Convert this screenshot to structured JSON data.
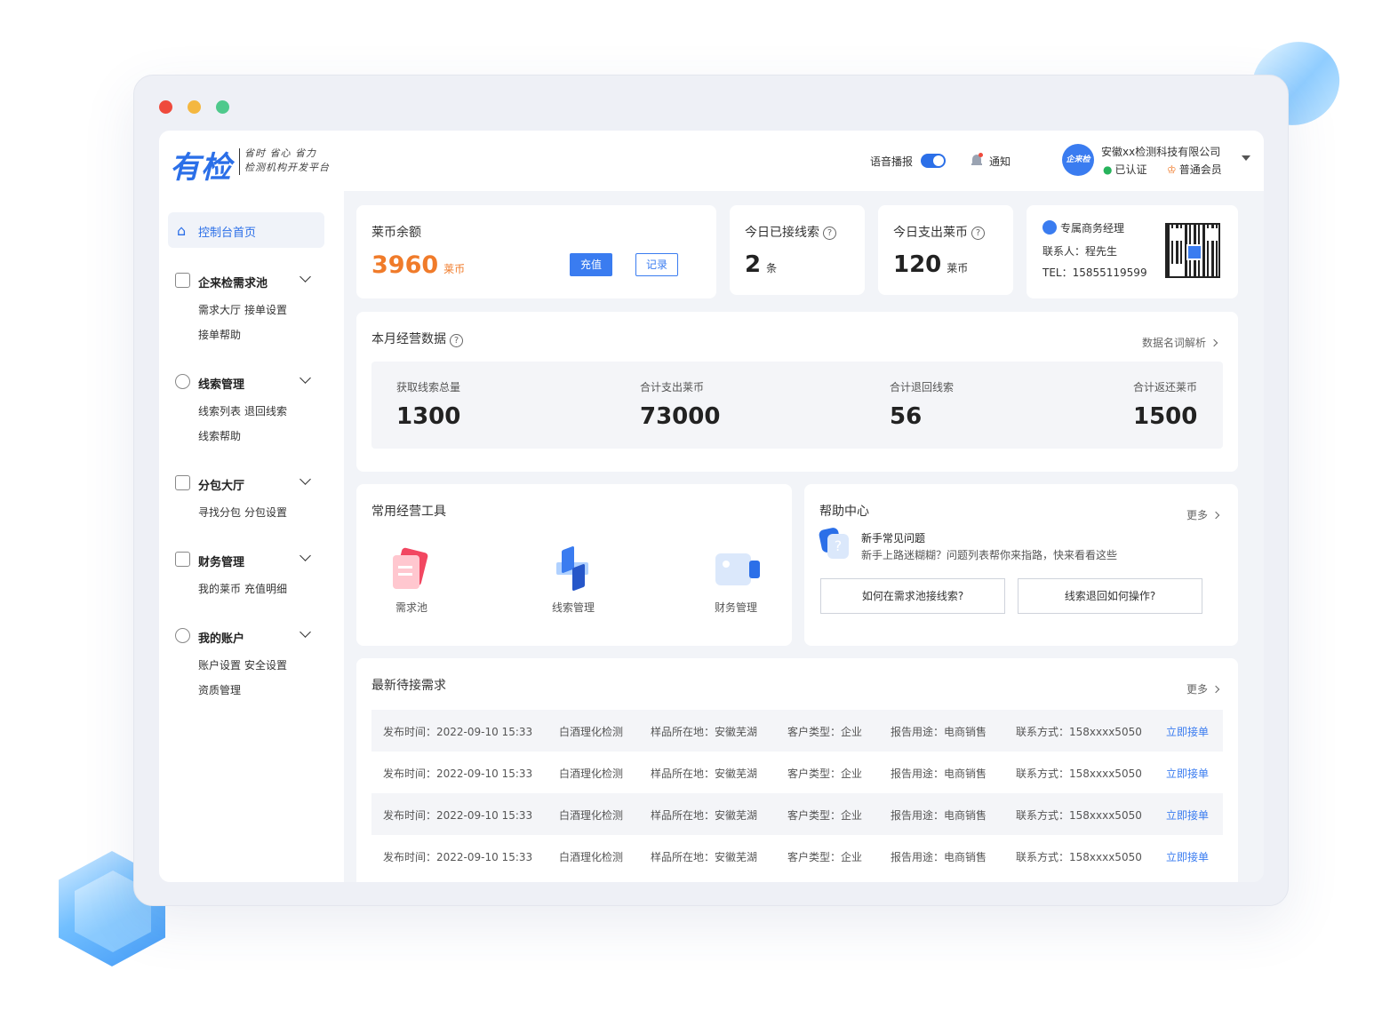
{
  "header": {
    "logo": "有检",
    "slogan_line1": "省时  省心  省力",
    "slogan_line2": "检测机构开发平台",
    "voice_label": "语音播报",
    "notify_label": "通知",
    "avatar_text": "企来检",
    "company": "安徽xx检测科技有限公司",
    "verified": "已认证",
    "member": "普通会员"
  },
  "sidebar": {
    "home": "控制台首页",
    "groups": [
      {
        "title": "企来检需求池",
        "links": [
          "需求大厅",
          "接单设置",
          "接单帮助"
        ]
      },
      {
        "title": "线索管理",
        "links": [
          "线索列表",
          "退回线索",
          "线索帮助"
        ]
      },
      {
        "title": "分包大厅",
        "links": [
          "寻找分包",
          "分包设置"
        ]
      },
      {
        "title": "财务管理",
        "links": [
          "我的莱币",
          "充值明细"
        ]
      },
      {
        "title": "我的账户",
        "links": [
          "账户设置",
          "安全设置",
          "资质管理"
        ]
      }
    ]
  },
  "balance": {
    "title": "莱币余额",
    "value": "3960",
    "unit": "莱币",
    "recharge": "充值",
    "record": "记录"
  },
  "today_leads": {
    "title": "今日已接线索",
    "value": "2",
    "unit": "条"
  },
  "today_spend": {
    "title": "今日支出莱币",
    "value": "120",
    "unit": "莱币"
  },
  "manager": {
    "title": "专属商务经理",
    "contact": "联系人：程先生",
    "tel": "TEL：15855119599"
  },
  "monthly": {
    "title": "本月经营数据",
    "link": "数据名词解析",
    "stats": [
      {
        "label": "获取线索总量",
        "value": "1300"
      },
      {
        "label": "合计支出莱币",
        "value": "73000"
      },
      {
        "label": "合计退回线索",
        "value": "56"
      },
      {
        "label": "合计返还莱币",
        "value": "1500"
      }
    ]
  },
  "tools": {
    "title": "常用经营工具",
    "items": [
      "需求池",
      "线索管理",
      "财务管理"
    ]
  },
  "help": {
    "title": "帮助中心",
    "more": "更多",
    "q_title": "新手常见问题",
    "q_desc": "新手上路迷糊糊？问题列表帮你来指路，快来看看这些",
    "btn1": "如何在需求池接线索?",
    "btn2": "线索退回如何操作?"
  },
  "latest": {
    "title": "最新待接需求",
    "more": "更多",
    "rows": [
      {
        "time": "发布时间：2022-09-10 15:33",
        "item": "白酒理化检测",
        "loc": "样品所在地：安徽芜湖",
        "ctype": "客户类型：企业",
        "use": "报告用途：电商销售",
        "contact": "联系方式：158xxxx5050",
        "action": "立即接单"
      },
      {
        "time": "发布时间：2022-09-10 15:33",
        "item": "白酒理化检测",
        "loc": "样品所在地：安徽芜湖",
        "ctype": "客户类型：企业",
        "use": "报告用途：电商销售",
        "contact": "联系方式：158xxxx5050",
        "action": "立即接单"
      },
      {
        "time": "发布时间：2022-09-10 15:33",
        "item": "白酒理化检测",
        "loc": "样品所在地：安徽芜湖",
        "ctype": "客户类型：企业",
        "use": "报告用途：电商销售",
        "contact": "联系方式：158xxxx5050",
        "action": "立即接单"
      },
      {
        "time": "发布时间：2022-09-10 15:33",
        "item": "白酒理化检测",
        "loc": "样品所在地：安徽芜湖",
        "ctype": "客户类型：企业",
        "use": "报告用途：电商销售",
        "contact": "联系方式：158xxxx5050",
        "action": "立即接单"
      }
    ]
  },
  "colors": {
    "accent": "#2b6fe8",
    "orange": "#f07b2a"
  }
}
